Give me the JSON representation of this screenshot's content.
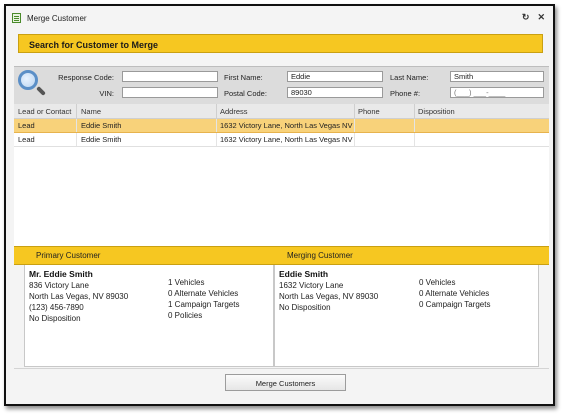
{
  "window": {
    "title": "Merge Customer",
    "refresh_symbol": "↻",
    "close_symbol": "✕"
  },
  "search": {
    "header": "Search for Customer to Merge",
    "response_code_label": "Response Code:",
    "response_code_value": "",
    "vin_label": "VIN:",
    "vin_value": "",
    "first_name_label": "First Name:",
    "first_name_value": "Eddie",
    "postal_code_label": "Postal Code:",
    "postal_code_value": "89030",
    "last_name_label": "Last Name:",
    "last_name_value": "Smith",
    "phone_label": "Phone #:",
    "phone_placeholder": "(___) ___-____"
  },
  "grid": {
    "columns": [
      "Lead or Contact",
      "Name",
      "Address",
      "Phone",
      "Disposition"
    ],
    "rows": [
      {
        "type": "Lead",
        "name": "Eddie Smith",
        "address": "1632 Victory Lane, North Las Vegas NV",
        "phone": "",
        "disposition": ""
      },
      {
        "type": "Lead",
        "name": "Eddie Smith",
        "address": "1632 Victory Lane, North Las Vegas NV",
        "phone": "",
        "disposition": ""
      }
    ]
  },
  "primary": {
    "header": "Primary Customer",
    "name": "Mr. Eddie Smith",
    "street": "836 Victory Lane",
    "city": "North Las Vegas, NV 89030",
    "phone": "(123) 456-7890",
    "disposition": "No Disposition",
    "vehicles": "1 Vehicles",
    "alt_vehicles": "0 Alternate Vehicles",
    "campaign_targets": "1 Campaign Targets",
    "policies": "0 Policies"
  },
  "merging": {
    "header": "Merging Customer",
    "name": "Eddie Smith",
    "street": "1632 Victory Lane",
    "city": "North Las Vegas, NV 89030",
    "disposition": "No Disposition",
    "vehicles": "0 Vehicles",
    "alt_vehicles": "0 Alternate Vehicles",
    "campaign_targets": "0 Campaign Targets"
  },
  "footer": {
    "merge_button": "Merge Customers"
  },
  "colors": {
    "accent_yellow": "#f6c721",
    "selected_row": "#f8d27a"
  }
}
